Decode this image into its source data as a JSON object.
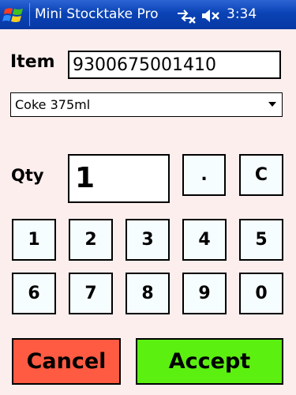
{
  "titlebar": {
    "app_title": "Mini Stocktake Pro",
    "time": "3:34"
  },
  "item": {
    "label": "Item",
    "value": "9300675001410"
  },
  "product_select": {
    "selected": "Coke 375ml"
  },
  "qty": {
    "label": "Qty",
    "value": "1"
  },
  "keypad": {
    "dot": ".",
    "clear": "C",
    "k1": "1",
    "k2": "2",
    "k3": "3",
    "k4": "4",
    "k5": "5",
    "k6": "6",
    "k7": "7",
    "k8": "8",
    "k9": "9",
    "k0": "0"
  },
  "actions": {
    "cancel": "Cancel",
    "accept": "Accept"
  },
  "colors": {
    "background": "#fdeeee",
    "cancel": "#ff5a42",
    "accept": "#5cf011",
    "titlebar": "#0a43b5"
  }
}
